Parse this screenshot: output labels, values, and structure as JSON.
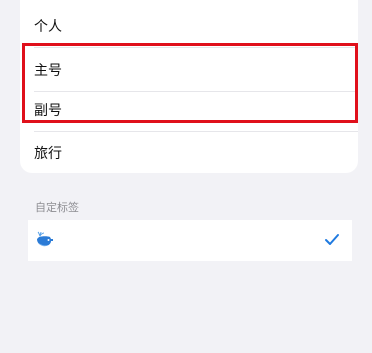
{
  "tags": {
    "items": [
      {
        "label": "个人"
      },
      {
        "label": "主号"
      },
      {
        "label": "副号"
      },
      {
        "label": "旅行"
      }
    ]
  },
  "custom_section": {
    "header": "自定标签",
    "items": [
      {
        "icon": "whale-icon",
        "selected": true
      }
    ]
  },
  "colors": {
    "background": "#f2f2f6",
    "highlight": "#e0101b",
    "accent": "#1f7ae0",
    "card": "#ffffff",
    "header_text": "#8e8e93"
  }
}
